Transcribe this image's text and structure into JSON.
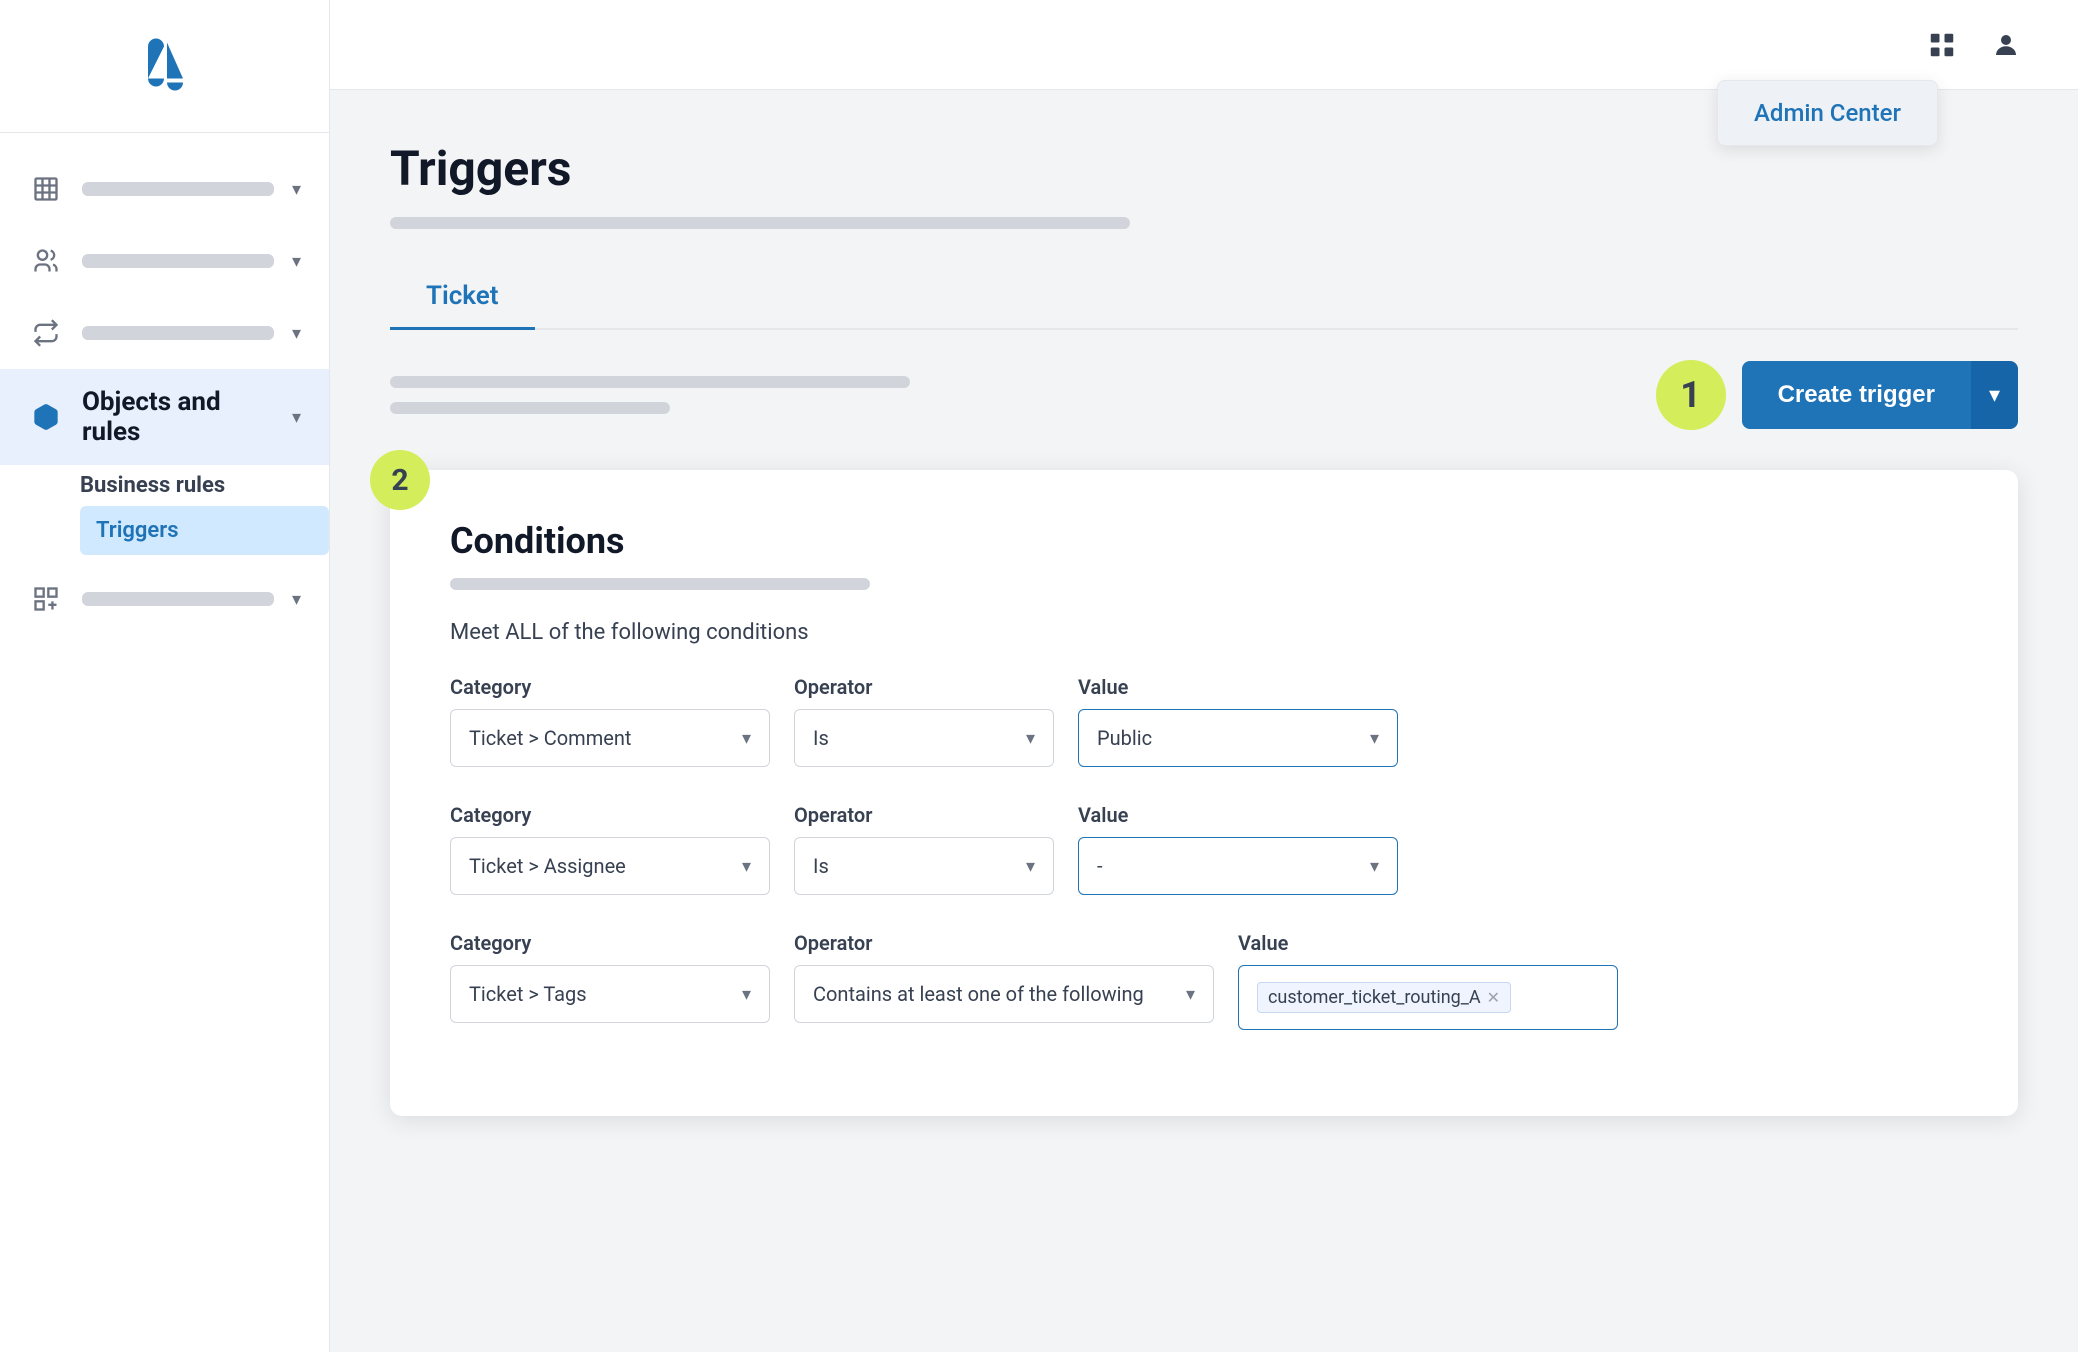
{
  "sidebar": {
    "logo_alt": "Zendesk logo",
    "nav_items": [
      {
        "id": "workspace",
        "icon": "building",
        "active": false
      },
      {
        "id": "people",
        "icon": "people",
        "active": false
      },
      {
        "id": "routing",
        "icon": "routing",
        "active": false
      },
      {
        "id": "objects-rules",
        "icon": "objects-rules",
        "label": "Objects and rules",
        "active": true
      },
      {
        "id": "apps",
        "icon": "apps",
        "active": false
      }
    ],
    "subnav": {
      "section": "Business rules",
      "items": [
        {
          "id": "triggers",
          "label": "Triggers",
          "active": true
        }
      ]
    }
  },
  "topbar": {
    "apps_icon": "grid-icon",
    "user_icon": "user-icon",
    "admin_dropdown": {
      "label": "Admin Center"
    }
  },
  "page": {
    "title": "Triggers",
    "title_bar_placeholder": "",
    "tabs": [
      {
        "id": "ticket",
        "label": "Ticket",
        "active": true
      }
    ],
    "step1_badge": "1",
    "create_trigger_label": "Create trigger",
    "create_trigger_dropdown_icon": "chevron-down"
  },
  "conditions_card": {
    "step_badge": "2",
    "title": "Conditions",
    "subtitle_bar": "",
    "meet_all_label": "Meet ALL of the following conditions",
    "rows": [
      {
        "category_label": "Category",
        "category_value": "Ticket > Comment",
        "operator_label": "Operator",
        "operator_value": "Is",
        "value_label": "Value",
        "value_value": "Public",
        "value_type": "select"
      },
      {
        "category_label": "Category",
        "category_value": "Ticket > Assignee",
        "operator_label": "Operator",
        "operator_value": "Is",
        "value_label": "Value",
        "value_value": "-",
        "value_type": "select"
      },
      {
        "category_label": "Category",
        "category_value": "Ticket > Tags",
        "operator_label": "Operator",
        "operator_value": "Contains at least one of the following",
        "value_label": "Value",
        "value_value": "customer_ticket_routing_A",
        "value_type": "tag"
      }
    ]
  }
}
